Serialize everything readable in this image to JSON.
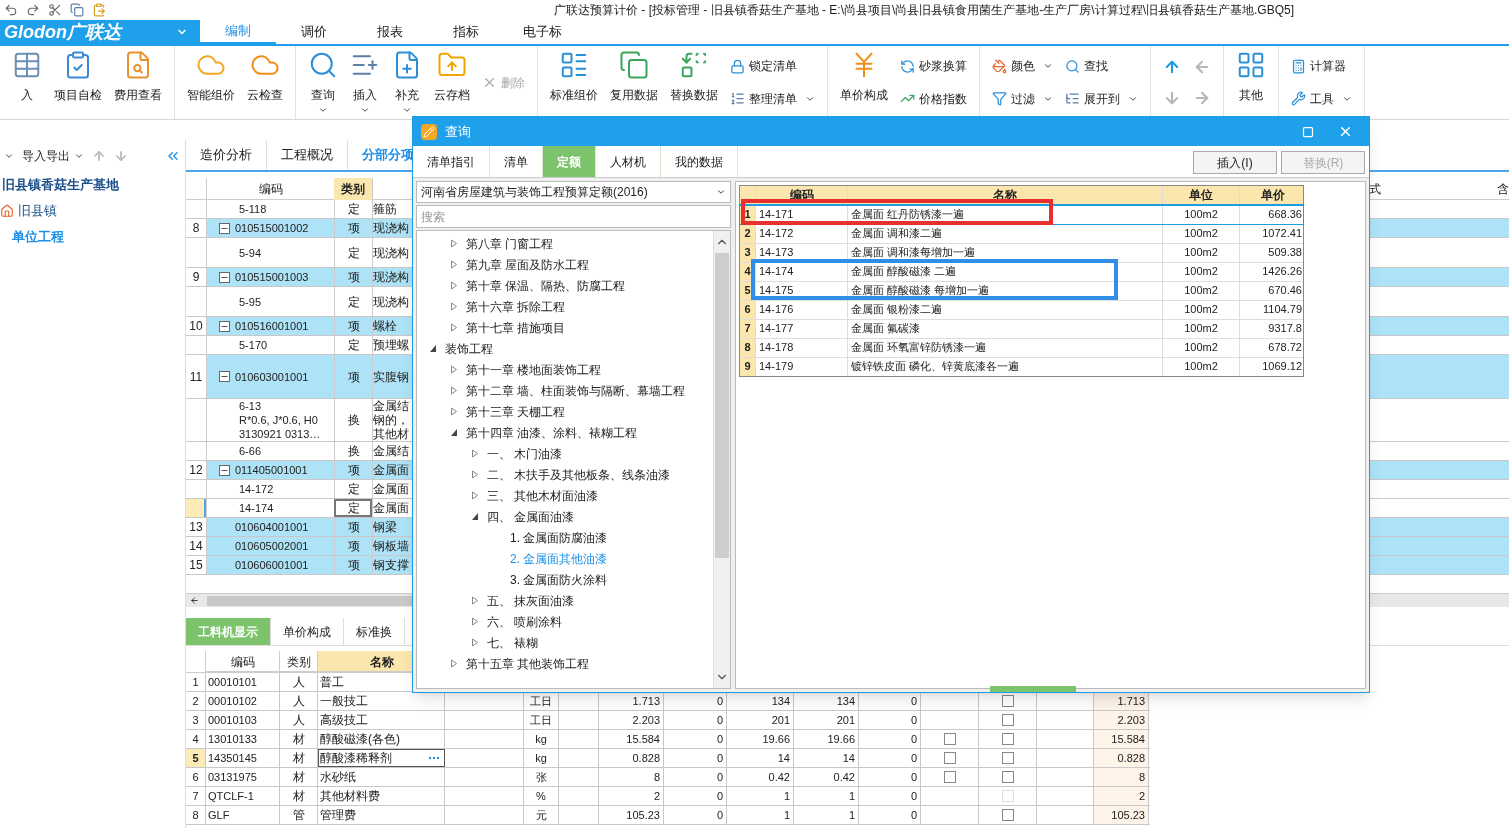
{
  "window": {
    "title": "广联达预算计价 - [投标管理 - 旧县镇香菇生产基地 - E:\\尚县项目\\尚县旧县镇食用菌生产基地-生产厂房\\计算过程\\旧县镇香菇生产基地.GBQ5]"
  },
  "logo": {
    "text": "Glodon广联达"
  },
  "menu_tabs": [
    {
      "label": "编制",
      "selected": true
    },
    {
      "label": "调价",
      "selected": false
    },
    {
      "label": "报表",
      "selected": false
    },
    {
      "label": "指标",
      "selected": false
    },
    {
      "label": "电子标",
      "selected": false
    }
  ],
  "ribbon": {
    "groups": [
      {
        "items": [
          {
            "kind": "large",
            "label": "入",
            "dropdown": false,
            "disabled": false
          },
          {
            "kind": "large",
            "label": "项目自检",
            "dropdown": false,
            "disabled": false
          },
          {
            "kind": "large",
            "label": "费用查看",
            "dropdown": false,
            "disabled": false
          }
        ]
      },
      {
        "items": [
          {
            "kind": "large",
            "label": "智能组价",
            "dropdown": false,
            "disabled": false
          },
          {
            "kind": "large",
            "label": "云检查",
            "dropdown": false,
            "disabled": false
          }
        ]
      },
      {
        "items": [
          {
            "kind": "large",
            "label": "查询",
            "dropdown": true,
            "disabled": false
          },
          {
            "kind": "large",
            "label": "插入",
            "dropdown": true,
            "disabled": false
          },
          {
            "kind": "large",
            "label": "补充",
            "dropdown": true,
            "disabled": false
          },
          {
            "kind": "large",
            "label": "云存档",
            "dropdown": false,
            "disabled": false
          },
          {
            "kind": "stack",
            "buttons": [
              {
                "label": "删除",
                "dropdown": false,
                "disabled": true
              }
            ]
          }
        ]
      },
      {
        "items": [
          {
            "kind": "large",
            "label": "标准组价",
            "dropdown": false,
            "disabled": false
          },
          {
            "kind": "large",
            "label": "复用数据",
            "dropdown": false,
            "disabled": false
          },
          {
            "kind": "large",
            "label": "替换数据",
            "dropdown": false,
            "disabled": false
          },
          {
            "kind": "stack",
            "buttons": [
              {
                "label": "锁定清单",
                "dropdown": false,
                "disabled": false
              },
              {
                "label": "整理清单",
                "dropdown": true,
                "disabled": false
              }
            ]
          }
        ]
      },
      {
        "items": [
          {
            "kind": "large",
            "label": "单价构成",
            "dropdown": false,
            "disabled": false
          },
          {
            "kind": "stack",
            "buttons": [
              {
                "label": "砂浆换算",
                "dropdown": false,
                "disabled": false
              },
              {
                "label": "价格指数",
                "dropdown": false,
                "disabled": false
              }
            ]
          }
        ]
      },
      {
        "items": [
          {
            "kind": "stack",
            "buttons": [
              {
                "label": "颜色",
                "dropdown": true,
                "disabled": false
              },
              {
                "label": "过滤",
                "dropdown": true,
                "disabled": false
              }
            ]
          },
          {
            "kind": "stack",
            "buttons": [
              {
                "label": "查找",
                "dropdown": false,
                "disabled": false
              },
              {
                "label": "展开到",
                "dropdown": true,
                "disabled": false
              }
            ]
          }
        ]
      },
      {
        "items": [
          {
            "kind": "arrows",
            "arrows": [
              {
                "disabled": false
              },
              {
                "disabled": true
              },
              {
                "disabled": true
              },
              {
                "disabled": true
              }
            ]
          }
        ]
      },
      {
        "items": [
          {
            "kind": "large",
            "label": "其他",
            "dropdown": false,
            "disabled": false
          }
        ]
      },
      {
        "items": [
          {
            "kind": "stack",
            "buttons": [
              {
                "label": "计算器",
                "dropdown": false,
                "disabled": false
              },
              {
                "label": "工具",
                "dropdown": true,
                "disabled": false
              }
            ]
          }
        ]
      }
    ]
  },
  "sidebar": {
    "toolbar_label": "导入导出",
    "project_tree": {
      "label": "旧县镇香菇生产基地",
      "selected": false,
      "children": [
        {
          "label": "旧县镇",
          "selected": false,
          "children": [
            {
              "label": "单位工程",
              "selected": true
            }
          ]
        }
      ]
    }
  },
  "main_tabs": [
    {
      "label": "造价分析",
      "selected": false
    },
    {
      "label": "工程概况",
      "selected": false
    },
    {
      "label": "分部分项",
      "selected": true
    }
  ],
  "main_table": {
    "columns": [
      "编码",
      "类别",
      "式",
      "含"
    ],
    "rows": [
      {
        "kind": "quota",
        "code": "5-118",
        "type": "定",
        "name": "箍筋",
        "selected": false
      },
      {
        "kind": "group",
        "no": "8",
        "code": "010515001002",
        "type": "项",
        "name": "现浇构",
        "expanded": true,
        "selected": false
      },
      {
        "kind": "quota",
        "code": "5-94",
        "type": "定",
        "name": "现浇构",
        "selected": false
      },
      {
        "kind": "group",
        "no": "9",
        "code": "010515001003",
        "type": "项",
        "name": "现浇构",
        "expanded": true,
        "selected": false
      },
      {
        "kind": "quota",
        "code": "5-95",
        "type": "定",
        "name": "现浇构",
        "selected": false
      },
      {
        "kind": "group",
        "no": "10",
        "code": "010516001001",
        "type": "项",
        "name": "螺栓",
        "expanded": true,
        "selected": false
      },
      {
        "kind": "quota",
        "code": "5-170",
        "type": "定",
        "name": "预埋螺",
        "selected": false
      },
      {
        "kind": "group",
        "no": "11",
        "code": "010603001001",
        "type": "项",
        "name": "实腹钢",
        "expanded": true,
        "selected": false
      },
      {
        "kind": "quota",
        "code": "6-13\nR*0.6, J*0.6, H0\n3130921 0313…",
        "type": "换",
        "name": "金属结钢的，其他材",
        "selected": false
      },
      {
        "kind": "quota",
        "code": "6-66",
        "type": "换",
        "name": "金属结",
        "selected": false
      },
      {
        "kind": "group",
        "no": "12",
        "code": "011405001001",
        "type": "项",
        "name": "金属面",
        "expanded": true,
        "selected": false
      },
      {
        "kind": "quota",
        "code": "14-172",
        "type": "定",
        "name": "金属面",
        "selected": false
      },
      {
        "kind": "quota",
        "code": "14-174",
        "type": "定",
        "name": "金属面",
        "selected": true
      },
      {
        "kind": "bill",
        "no": "13",
        "code": "010604001001",
        "type": "项",
        "name": "钢梁",
        "selected": false
      },
      {
        "kind": "bill",
        "no": "14",
        "code": "010605002001",
        "type": "项",
        "name": "钢板墙",
        "selected": false
      },
      {
        "kind": "bill",
        "no": "15",
        "code": "010606001001",
        "type": "项",
        "name": "钢支撑",
        "selected": false
      }
    ]
  },
  "bottom_tabs": [
    {
      "label": "工料机显示",
      "selected": true
    },
    {
      "label": "单价构成",
      "selected": false
    },
    {
      "label": "标准换",
      "selected": false
    }
  ],
  "bottom_table": {
    "columns": [
      "编码",
      "类别",
      "名称"
    ],
    "rows": [
      {
        "no": "1",
        "code": "00010101",
        "type": "人",
        "name": "普工",
        "selected": false
      },
      {
        "no": "2",
        "code": "00010102",
        "type": "人",
        "name": "一般技工",
        "unit": "工日",
        "qty": "1.713",
        "col_7": "0",
        "price": "134",
        "price_2": "134",
        "col_10": "0",
        "check_b": {
          "checked": false,
          "disabled": false
        },
        "total": "1.713",
        "selected": false
      },
      {
        "no": "3",
        "code": "00010103",
        "type": "人",
        "name": "高级技工",
        "unit": "工日",
        "qty": "2.203",
        "col_7": "0",
        "price": "201",
        "price_2": "201",
        "col_10": "0",
        "check_b": {
          "checked": false,
          "disabled": false
        },
        "total": "2.203",
        "selected": false
      },
      {
        "no": "4",
        "code": "13010133",
        "type": "材",
        "name": "醇酸磁漆(各色)",
        "unit": "kg",
        "qty": "15.584",
        "col_7": "0",
        "price": "19.66",
        "price_2": "19.66",
        "col_10": "0",
        "check_a": {
          "checked": false,
          "disabled": false
        },
        "check_b": {
          "checked": false,
          "disabled": false
        },
        "total": "15.584",
        "selected": false
      },
      {
        "no": "5",
        "code": "14350145",
        "type": "材",
        "name": "醇酸漆稀释剂",
        "unit": "kg",
        "qty": "0.828",
        "col_7": "0",
        "price": "14",
        "price_2": "14",
        "col_10": "0",
        "check_a": {
          "checked": false,
          "disabled": false
        },
        "check_b": {
          "checked": false,
          "disabled": false
        },
        "total": "0.828",
        "selected": true
      },
      {
        "no": "6",
        "code": "03131975",
        "type": "材",
        "name": "水砂纸",
        "unit": "张",
        "qty": "8",
        "col_7": "0",
        "price": "0.42",
        "price_2": "0.42",
        "col_10": "0",
        "check_a": {
          "checked": false,
          "disabled": false
        },
        "check_b": {
          "checked": false,
          "disabled": false
        },
        "total": "8",
        "selected": false
      },
      {
        "no": "7",
        "code": "QTCLF-1",
        "type": "材",
        "name": "其他材料费",
        "unit": "%",
        "qty": "2",
        "col_7": "0",
        "price": "1",
        "price_2": "1",
        "col_10": "0",
        "check_b": {
          "checked": false,
          "disabled": true
        },
        "total": "2",
        "selected": false
      },
      {
        "no": "8",
        "code": "GLF",
        "type": "管",
        "name": "管理费",
        "unit": "元",
        "qty": "105.23",
        "col_7": "0",
        "price": "1",
        "price_2": "1",
        "col_10": "0",
        "check_b": {
          "checked": false,
          "disabled": false
        },
        "total": "105.23",
        "selected": false
      }
    ]
  },
  "dialog": {
    "title": "查询",
    "tabs": [
      {
        "label": "清单指引",
        "selected": false
      },
      {
        "label": "清单",
        "selected": false
      },
      {
        "label": "定额",
        "selected": true
      },
      {
        "label": "人材机",
        "selected": false
      },
      {
        "label": "我的数据",
        "selected": false
      }
    ],
    "buttons": [
      {
        "label": "插入(I)",
        "disabled": false
      },
      {
        "label": "替换(R)",
        "disabled": true
      }
    ],
    "library": "河南省房屋建筑与装饰工程预算定额(2016)",
    "search": {
      "placeholder": "搜索"
    },
    "tree": {
      "scrolled_children": [
        {
          "label": "第八章 门窗工程",
          "expanded": false,
          "selected": false
        },
        {
          "label": "第九章 屋面及防水工程",
          "expanded": false,
          "selected": false
        },
        {
          "label": "第十章 保温、隔热、防腐工程",
          "expanded": false,
          "selected": false
        },
        {
          "label": "第十六章 拆除工程",
          "expanded": false,
          "selected": false
        },
        {
          "label": "第十七章 措施项目",
          "expanded": false,
          "selected": false
        }
      ],
      "items": [
        {
          "label": "装饰工程",
          "expanded": true,
          "selected": false,
          "children": [
            {
              "label": "第十一章 楼地面装饰工程",
              "expanded": false,
              "selected": false
            },
            {
              "label": "第十二章 墙、柱面装饰与隔断、幕墙工程",
              "expanded": false,
              "selected": false
            },
            {
              "label": "第十三章 天棚工程",
              "expanded": false,
              "selected": false
            },
            {
              "label": "第十四章 油漆、涂料、裱糊工程",
              "expanded": true,
              "selected": false,
              "children": [
                {
                  "label": "一、 木门油漆",
                  "expanded": false,
                  "selected": false
                },
                {
                  "label": "二、 木扶手及其他板条、线条油漆",
                  "expanded": false,
                  "selected": false
                },
                {
                  "label": "三、 其他木材面油漆",
                  "expanded": false,
                  "selected": false
                },
                {
                  "label": "四、 金属面油漆",
                  "expanded": true,
                  "selected": false,
                  "children": [
                    {
                      "label": "1. 金属面防腐油漆",
                      "selected": false
                    },
                    {
                      "label": "2. 金属面其他油漆",
                      "selected": true
                    },
                    {
                      "label": "3. 金属面防火涂料",
                      "selected": false
                    }
                  ]
                },
                {
                  "label": "五、 抹灰面油漆",
                  "expanded": false,
                  "selected": false
                },
                {
                  "label": "六、 喷刷涂料",
                  "expanded": false,
                  "selected": false
                },
                {
                  "label": "七、 裱糊",
                  "expanded": false,
                  "selected": false
                }
              ]
            },
            {
              "label": "第十五章 其他装饰工程",
              "expanded": false,
              "selected": false
            }
          ]
        }
      ]
    },
    "table": {
      "columns": [
        "编码",
        "名称",
        "单位",
        "单价"
      ],
      "rows": [
        {
          "no": "1",
          "code": "14-171",
          "name": "金属面 红丹防锈漆一遍",
          "unit": "100m2",
          "price": "668.36",
          "selected": true
        },
        {
          "no": "2",
          "code": "14-172",
          "name": "金属面 调和漆二遍",
          "unit": "100m2",
          "price": "1072.41",
          "selected": false
        },
        {
          "no": "3",
          "code": "14-173",
          "name": "金属面 调和漆每增加一遍",
          "unit": "100m2",
          "price": "509.38",
          "selected": false
        },
        {
          "no": "4",
          "code": "14-174",
          "name": "金属面 醇酸磁漆 二遍",
          "unit": "100m2",
          "price": "1426.26",
          "selected": false
        },
        {
          "no": "5",
          "code": "14-175",
          "name": "金属面 醇酸磁漆 每增加一遍",
          "unit": "100m2",
          "price": "670.46",
          "selected": false
        },
        {
          "no": "6",
          "code": "14-176",
          "name": "金属面 银粉漆二遍",
          "unit": "100m2",
          "price": "1104.79",
          "selected": false
        },
        {
          "no": "7",
          "code": "14-177",
          "name": "金属面 氟碳漆",
          "unit": "100m2",
          "price": "9317.8",
          "selected": false
        },
        {
          "no": "8",
          "code": "14-178",
          "name": "金属面 环氧富锌防锈漆一遍",
          "unit": "100m2",
          "price": "678.72",
          "selected": false
        },
        {
          "no": "9",
          "code": "14-179",
          "name": "镀锌铁皮面 磷化、锌黄底漆各一遍",
          "unit": "100m2",
          "price": "1069.12",
          "selected": false
        }
      ]
    },
    "annotations": [
      {
        "color": "#e8312f"
      },
      {
        "color": "#2f8ee6"
      }
    ]
  }
}
